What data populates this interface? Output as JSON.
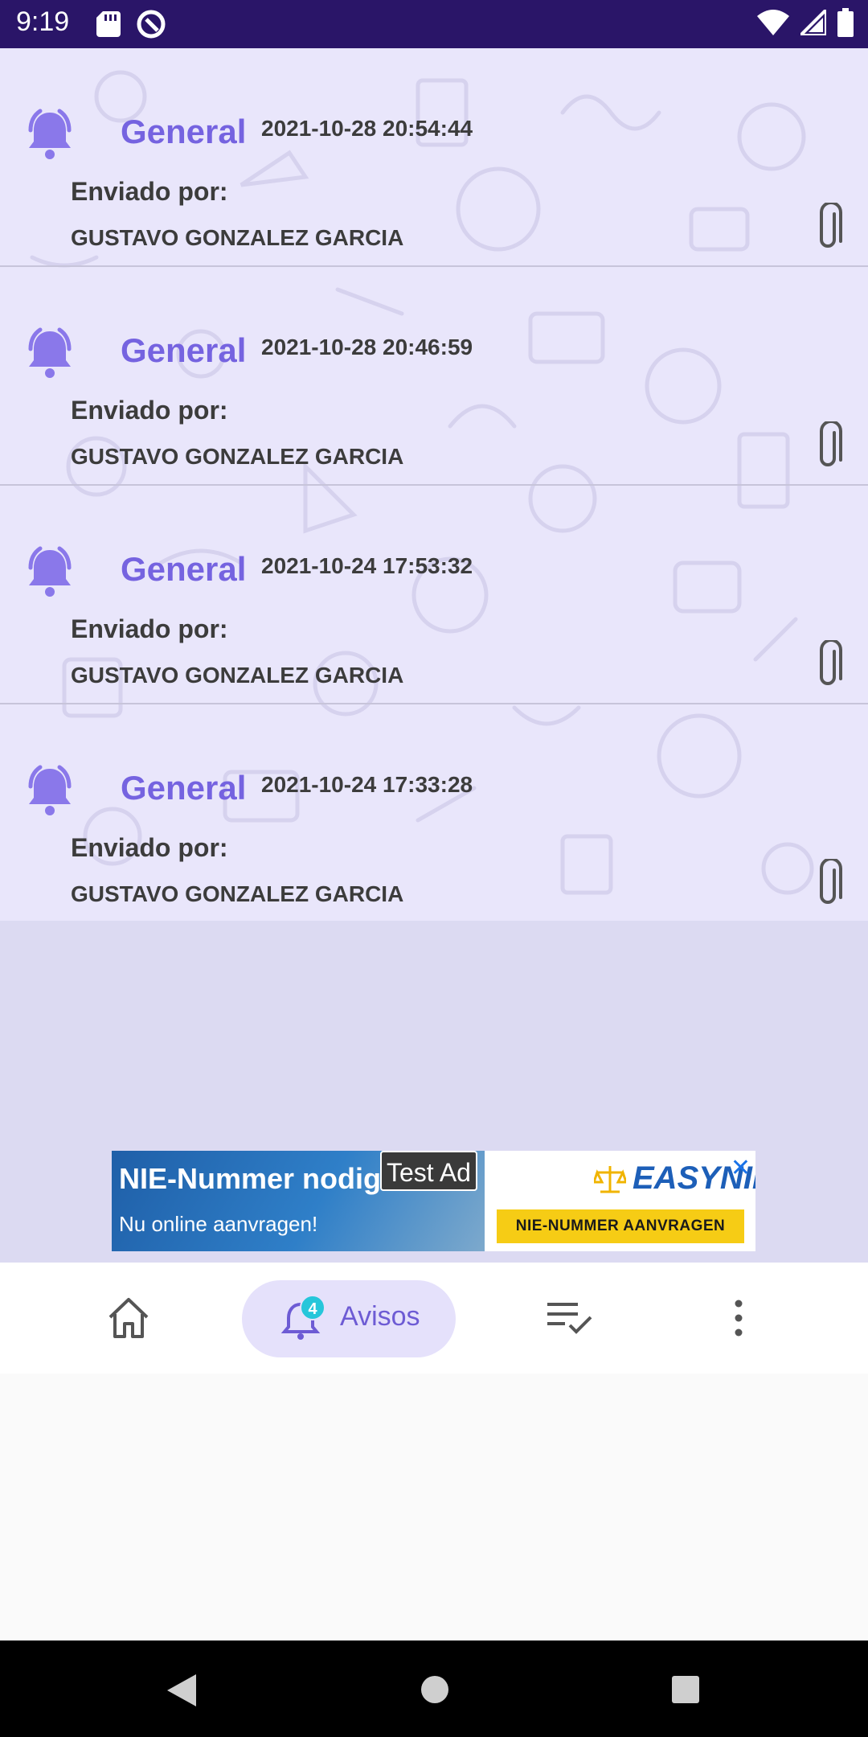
{
  "status_bar": {
    "time": "9:19",
    "icons": [
      "sd-card-icon",
      "data-saver-icon",
      "wifi-icon",
      "signal-icon",
      "battery-icon"
    ]
  },
  "notices": [
    {
      "title": "General",
      "date": "2021-10-28 20:54:44",
      "sent_label": "Enviado por:",
      "sender": "GUSTAVO GONZALEZ GARCIA"
    },
    {
      "title": "General",
      "date": "2021-10-28 20:46:59",
      "sent_label": "Enviado por:",
      "sender": "GUSTAVO GONZALEZ GARCIA"
    },
    {
      "title": "General",
      "date": "2021-10-24 17:53:32",
      "sent_label": "Enviado por:",
      "sender": "GUSTAVO GONZALEZ GARCIA"
    },
    {
      "title": "General",
      "date": "2021-10-24 17:33:28",
      "sent_label": "Enviado por:",
      "sender": "GUSTAVO GONZALEZ GARCIA"
    }
  ],
  "ad": {
    "headline": "NIE-Nummer nodig",
    "subline": "Nu online aanvragen!",
    "badge": "Test Ad",
    "brand": "EASYNIE",
    "cta": "NIE-NUMMER AANVRAGEN",
    "close": "✕"
  },
  "bottom_nav": {
    "active_label": "Avisos",
    "badge_count": "4",
    "items": [
      "home-icon",
      "bell-icon",
      "task-list-icon",
      "more-vert-icon"
    ]
  },
  "colors": {
    "accent": "#7563e0",
    "status_bar": "#2a1568",
    "list_bg": "#e9e6fb",
    "badge": "#26c6da"
  }
}
